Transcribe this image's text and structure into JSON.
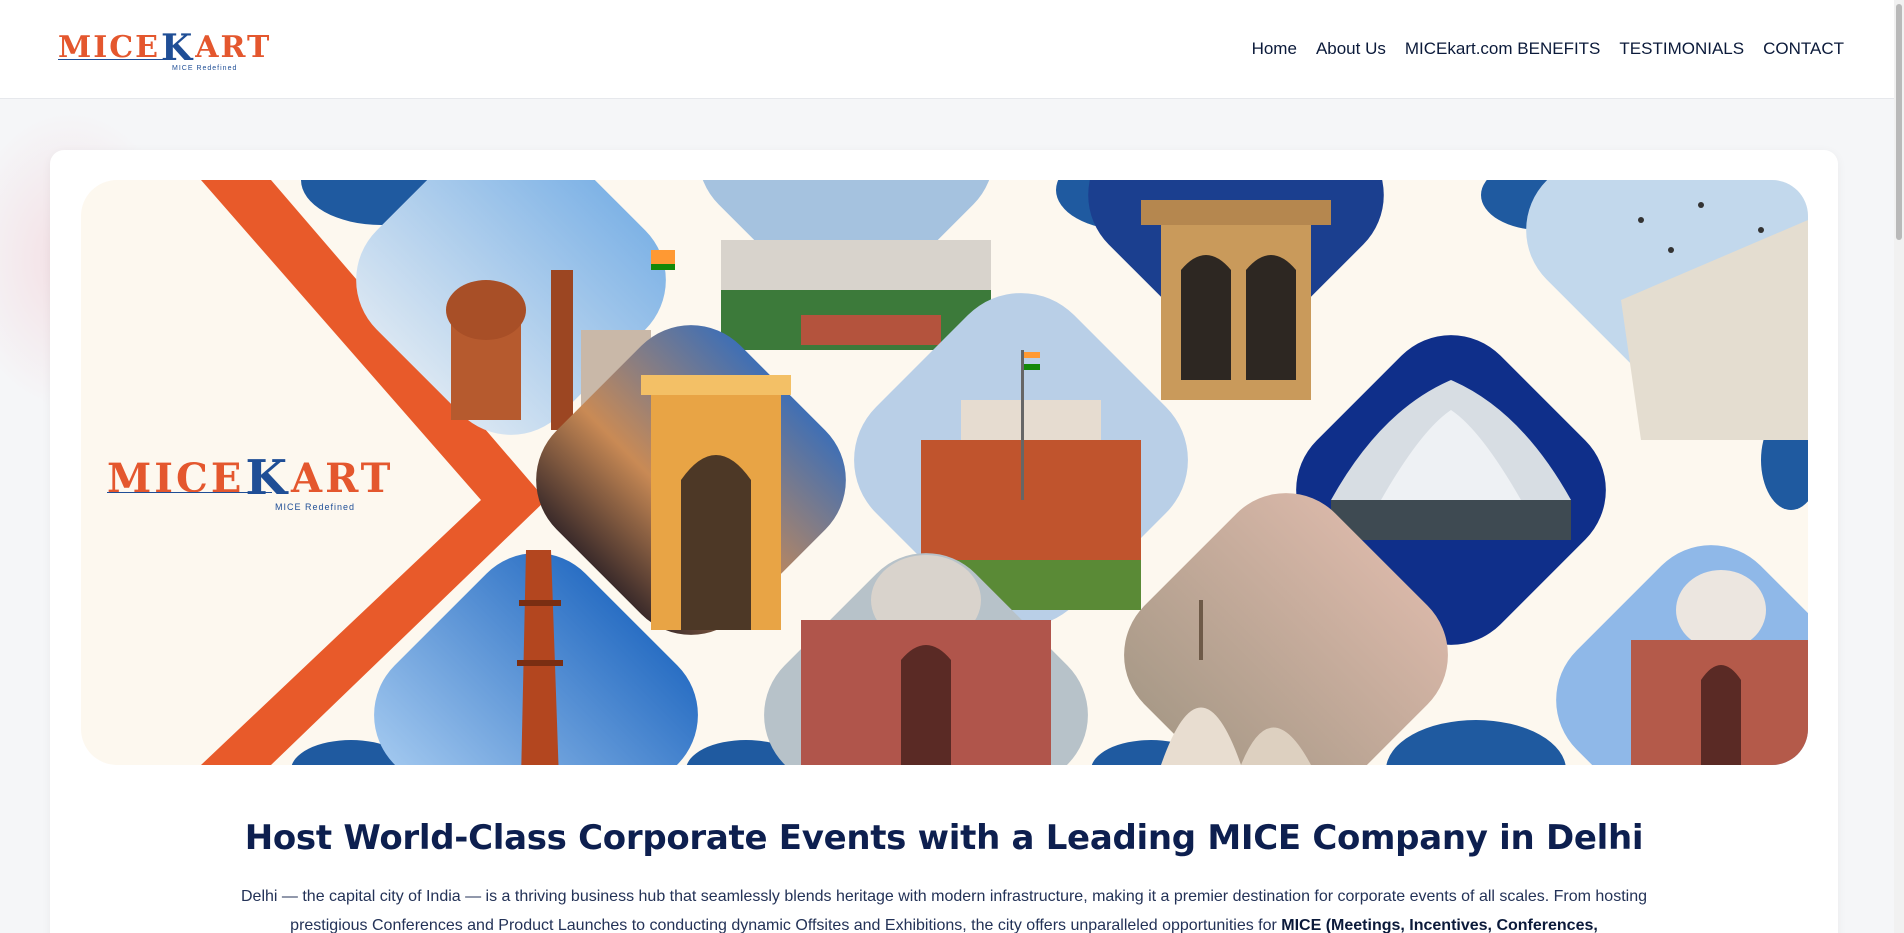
{
  "header": {
    "logo": {
      "text_left": "MICE",
      "text_k": "K",
      "text_right": "ART",
      "tagline": "MICE Redefined"
    },
    "nav": [
      {
        "label": "Home"
      },
      {
        "label": "About Us"
      },
      {
        "label": "MICEkart.com BENEFITS"
      },
      {
        "label": "TESTIMONIALS"
      },
      {
        "label": "CONTACT"
      }
    ]
  },
  "banner": {
    "logo": {
      "text_left": "MICE",
      "text_k": "K",
      "text_right": "ART",
      "tagline": "MICE Redefined"
    },
    "tiles": [
      "Red Fort",
      "Parliament House",
      "Mughal pavilion",
      "Jama Masjid minarets",
      "India Gate",
      "Red Fort",
      "Lotus Temple",
      "Qutub Minar",
      "Humayun's Tomb",
      "Jama Masjid domes",
      "Humayun's Tomb"
    ]
  },
  "content": {
    "headline": "Host World-Class Corporate Events with a Leading MICE Company in Delhi",
    "description_part1": "Delhi — the capital city of India — is a thriving business hub that seamlessly blends heritage with modern infrastructure, making it a premier destination for corporate events of all scales. From hosting prestigious Conferences and Product Launches to conducting dynamic Offsites and Exhibitions, the city offers unparalleled opportunities for ",
    "description_bold": "MICE (Meetings, Incentives, Conferences,"
  },
  "colors": {
    "accent_orange": "#e4572e",
    "brand_blue": "#1f4e96",
    "navy_text": "#0d1f4f",
    "banner_bg": "#fdf8ef"
  }
}
